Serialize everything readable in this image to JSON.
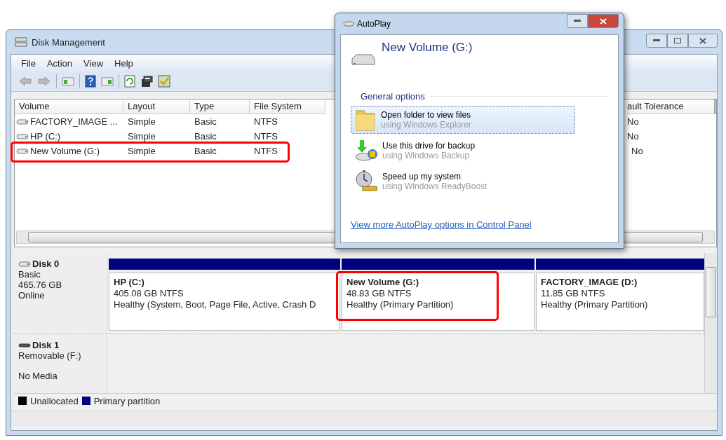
{
  "window": {
    "title": "Disk Management"
  },
  "menu": [
    "File",
    "Action",
    "View",
    "Help"
  ],
  "volume_table": {
    "columns": [
      "Volume",
      "Layout",
      "Type",
      "File System",
      "ault Tolerance"
    ],
    "rows": [
      {
        "cells": [
          "FACTORY_IMAGE ...",
          "Simple",
          "Basic",
          "NTFS",
          "No"
        ],
        "highlighted": false
      },
      {
        "cells": [
          "HP (C:)",
          "Simple",
          "Basic",
          "NTFS",
          "No"
        ],
        "highlighted": false
      },
      {
        "cells": [
          "New Volume (G:)",
          "Simple",
          "Basic",
          "NTFS",
          "No"
        ],
        "highlighted": true
      }
    ]
  },
  "disks": [
    {
      "kind": "fixed",
      "name": "Disk 0",
      "lines": [
        "Basic",
        "465.76 GB",
        "Online"
      ],
      "partitions": [
        {
          "name": "HP  (C:)",
          "size": "405.08 GB NTFS",
          "status": "Healthy (System, Boot, Page File, Active, Crash D",
          "highlighted": false
        },
        {
          "name": "New Volume  (G:)",
          "size": "48.83 GB NTFS",
          "status": "Healthy (Primary Partition)",
          "highlighted": true
        },
        {
          "name": "FACTORY_IMAGE  (D:)",
          "size": "11.85 GB NTFS",
          "status": "Healthy (Primary Partition)",
          "highlighted": false
        }
      ]
    },
    {
      "kind": "removable",
      "name": "Disk 1",
      "lines": [
        "Removable (F:)",
        "No Media"
      ]
    }
  ],
  "legend": [
    {
      "label": "Unallocated",
      "color": "#000000"
    },
    {
      "label": "Primary partition",
      "color": "#000080"
    }
  ],
  "autoplay": {
    "title": "AutoPlay",
    "device": "New Volume (G:)",
    "section": "General options",
    "options": [
      {
        "kind": "folder",
        "title": "Open folder to view files",
        "subtitle": "using Windows Explorer",
        "selected": true
      },
      {
        "kind": "backup",
        "title": "Use this drive for backup",
        "subtitle": "using Windows Backup",
        "selected": false
      },
      {
        "kind": "speed",
        "title": "Speed up my system",
        "subtitle": "using Windows ReadyBoost",
        "selected": false
      }
    ],
    "link": "View more AutoPlay options in Control Panel"
  }
}
